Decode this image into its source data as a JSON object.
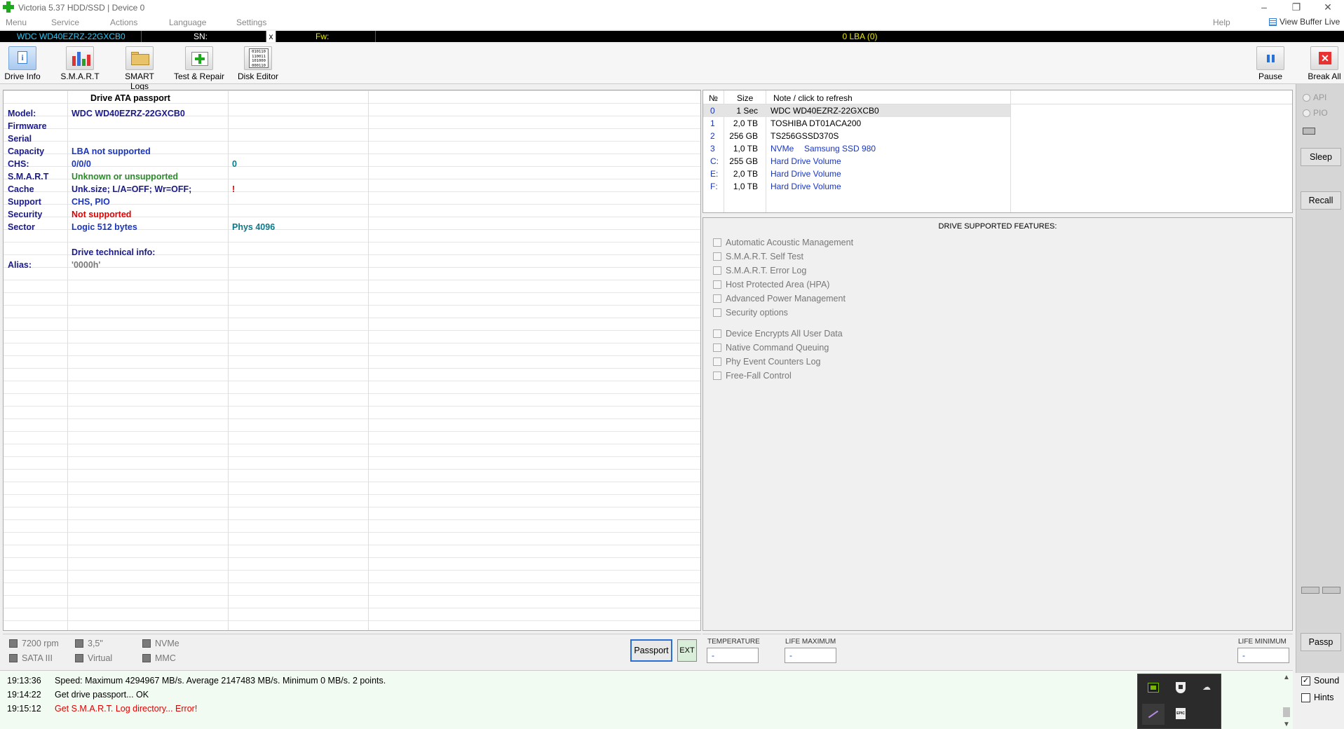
{
  "window": {
    "title": "Victoria 5.37 HDD/SSD | Device 0",
    "min": "–",
    "restore": "❐",
    "close": "✕"
  },
  "menu": {
    "items": [
      "Menu",
      "Service",
      "Actions",
      "Language",
      "Settings"
    ],
    "help": "Help",
    "view_buffer_live": "View Buffer Live"
  },
  "infobar": {
    "model": "WDC WD40EZRZ-22GXCB0",
    "sn_label": "SN:",
    "x": "x",
    "fw_label": "Fw:",
    "lba": "0 LBA (0)"
  },
  "toolbar": {
    "drive_info": "Drive Info",
    "smart": "S.M.A.R.T",
    "smart_logs": "SMART Logs",
    "test_repair": "Test & Repair",
    "disk_editor": "Disk Editor",
    "disk_editor_bits": "010110\n110011\n101000\n000110",
    "pause": "Pause",
    "break_all": "Break All"
  },
  "passport": {
    "header": "Drive ATA passport",
    "rows": [
      {
        "label": "Model:",
        "value": "WDC WD40EZRZ-22GXCB0",
        "extra": "",
        "color": "#1a1a8c",
        "extra_color": "#1a1a8c"
      },
      {
        "label": "Firmware",
        "value": "",
        "extra": "",
        "color": "#1a1a8c",
        "extra_color": "#1a1a8c"
      },
      {
        "label": "Serial",
        "value": "",
        "extra": "",
        "color": "#1a1a8c",
        "extra_color": "#1a1a8c"
      },
      {
        "label": "Capacity",
        "value": "LBA not supported",
        "extra": "",
        "color": "#1a35c0",
        "extra_color": "#1a1a8c"
      },
      {
        "label": "CHS:",
        "value": "0/0/0",
        "extra": "0",
        "color": "#1a35c0",
        "extra_color": "#0a7a8a"
      },
      {
        "label": "S.M.A.R.T",
        "value": "Unknown or unsupported",
        "extra": "",
        "color": "#2a8a2a",
        "extra_color": "#1a1a8c"
      },
      {
        "label": "Cache",
        "value": "Unk.size; L/A=OFF; Wr=OFF;",
        "extra": "!",
        "color": "#1a1a8c",
        "extra_color": "#e00000"
      },
      {
        "label": "Support",
        "value": "CHS, PIO",
        "extra": "",
        "color": "#1a35c0",
        "extra_color": "#1a1a8c"
      },
      {
        "label": "Security",
        "value": "Not supported",
        "extra": "",
        "color": "#e00000",
        "extra_color": "#1a1a8c"
      },
      {
        "label": "Sector",
        "value": "Logic 512 bytes",
        "extra": "Phys 4096",
        "color": "#1a35c0",
        "extra_color": "#0a7a8a"
      },
      {
        "label": "",
        "value": "",
        "extra": "",
        "color": "#1a1a8c",
        "extra_color": "#1a1a8c"
      },
      {
        "label": "",
        "value": "Drive technical info:",
        "extra": "",
        "color": "#1a1a8c",
        "extra_color": "#1a1a8c"
      },
      {
        "label": "Alias:",
        "value": "'0000h'",
        "extra": "",
        "color": "#777777",
        "extra_color": "#1a1a8c"
      }
    ]
  },
  "drives": {
    "headers": {
      "num": "№",
      "size": "Size",
      "note": "Note / click to refresh"
    },
    "rows": [
      {
        "num": "0",
        "size": "1 Sec",
        "type": "",
        "name": "WDC WD40EZRZ-22GXCB0",
        "name_color": "#000000",
        "selected": true
      },
      {
        "num": "1",
        "size": "2,0 TB",
        "type": "",
        "name": "TOSHIBA DT01ACA200",
        "name_color": "#000000",
        "selected": false
      },
      {
        "num": "2",
        "size": "256 GB",
        "type": "",
        "name": "TS256GSSD370S",
        "name_color": "#000000",
        "selected": false
      },
      {
        "num": "3",
        "size": "1,0 TB",
        "type": "NVMe",
        "name": "Samsung SSD 980",
        "name_color": "#1a35c0",
        "selected": false
      },
      {
        "num": "C:",
        "size": "255 GB",
        "type": "",
        "name": "Hard Drive Volume",
        "name_color": "#1a35c0",
        "selected": false
      },
      {
        "num": "E:",
        "size": "2,0 TB",
        "type": "",
        "name": "Hard Drive Volume",
        "name_color": "#1a35c0",
        "selected": false
      },
      {
        "num": "F:",
        "size": "1,0 TB",
        "type": "",
        "name": "Hard Drive Volume",
        "name_color": "#1a35c0",
        "selected": false
      }
    ]
  },
  "features": {
    "title": "DRIVE SUPPORTED FEATURES:",
    "group1": [
      "Automatic Acoustic Management",
      "S.M.A.R.T. Self Test",
      "S.M.A.R.T. Error Log",
      "Host Protected Area (HPA)",
      "Advanced Power Management",
      "Security options"
    ],
    "group2": [
      "Device Encrypts All User Data",
      "Native Command Queuing",
      "Phy Event Counters Log",
      "Free-Fall Control"
    ]
  },
  "side": {
    "api": "API",
    "pio": "PIO",
    "sleep": "Sleep",
    "recall": "Recall",
    "passp": "Passp",
    "sound": "Sound",
    "hints": "Hints",
    "sound_checked": true,
    "hints_checked": false
  },
  "indicators": {
    "rpm": "7200 rpm",
    "form": "3,5\"",
    "nvme": "NVMe",
    "sata": "SATA III",
    "virtual": "Virtual",
    "mmc": "MMC"
  },
  "buttons": {
    "passport": "Passport",
    "ext": "EXT"
  },
  "status_fields": {
    "temperature_label": "TEMPERATURE",
    "temperature": "-",
    "life_max_label": "LIFE MAXIMUM",
    "life_max": "-",
    "life_min_label": "LIFE MINIMUM",
    "life_min": "-"
  },
  "log": [
    {
      "time": "19:13:36",
      "text": "Speed: Maximum 4294967 MB/s. Average 2147483 MB/s. Minimum 0 MB/s. 2 points.",
      "color": "#000000"
    },
    {
      "time": "19:14:22",
      "text": "Get drive passport... OK",
      "color": "#000000"
    },
    {
      "time": "19:15:12",
      "text": "Get S.M.A.R.T. Log directory... Error!",
      "color": "#e00000"
    }
  ],
  "tray": {
    "icons": [
      "nvidia-icon",
      "shield-icon",
      "cloud-off-icon",
      "pen-icon",
      "epic-games-icon"
    ],
    "epic_text": "EPIC"
  }
}
